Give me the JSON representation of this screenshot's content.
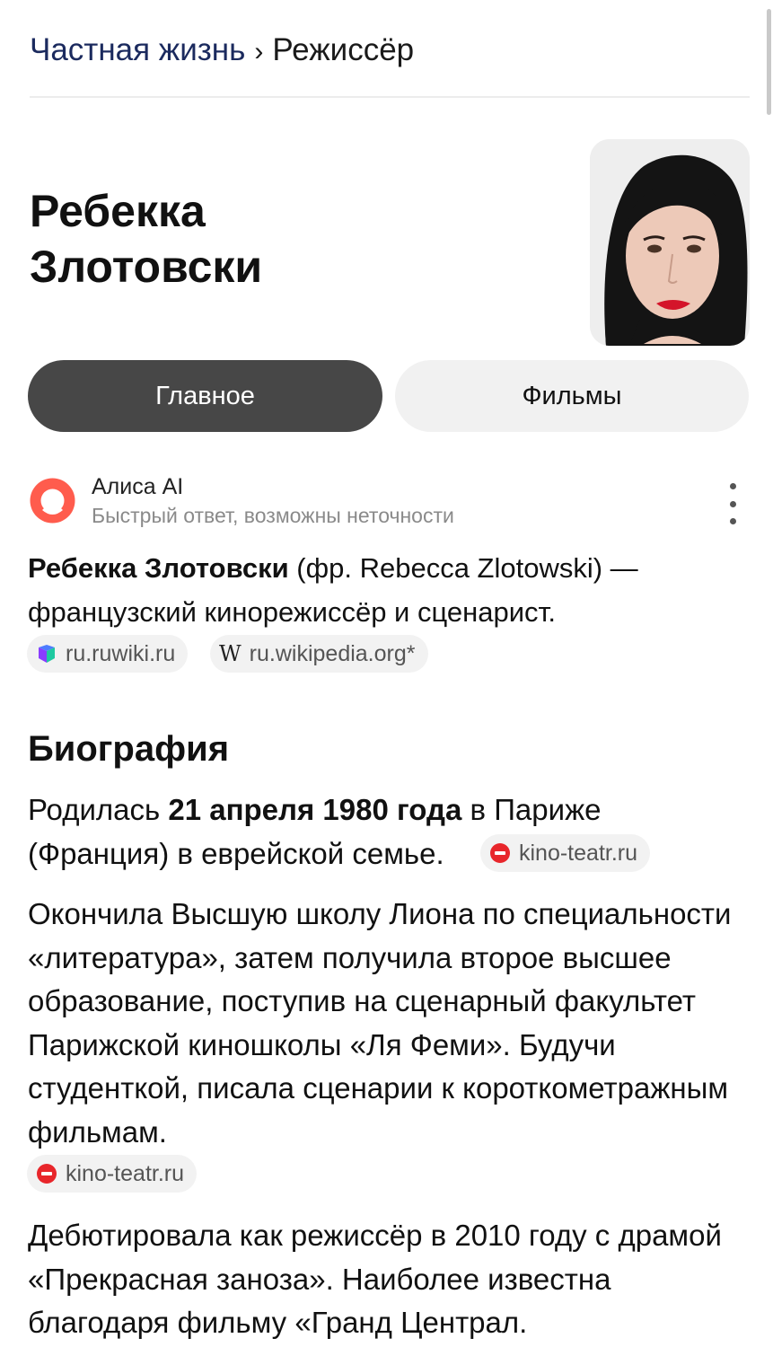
{
  "breadcrumb": {
    "parent": "Частная жизнь",
    "separator": "›",
    "current": "Режиссёр"
  },
  "person": {
    "name_line1": "Ребекка",
    "name_line2": "Злотовски"
  },
  "tabs": [
    {
      "label": "Главное",
      "active": true
    },
    {
      "label": "Фильмы",
      "active": false
    }
  ],
  "alice": {
    "title": "Алиса AI",
    "subtitle": "Быстрый ответ, возможны неточности",
    "summary_name": "Ребекка Злотовски",
    "summary_rest": " (фр. Rebecca Zlotowski) — французский кинорежиссёр и сценарист.",
    "sources": [
      {
        "label": "ru.ruwiki.ru"
      },
      {
        "label": "ru.wikipedia.org*",
        "icon_letter": "W"
      }
    ]
  },
  "biography": {
    "title": "Биография",
    "p1_before": "Родилась ",
    "p1_bold": "21 апреля 1980 года",
    "p1_after": " в Париже (Франция) в еврейской семье.",
    "p1_source": "kino-teatr.ru",
    "p2_text": "Окончила Высшую школу Лиона по специальности «литература», затем получила второе высшее образование, поступив на сценарный факультет Парижской киношколы «Ля Феми». Будучи студенткой, писала сценарии к короткометражным фильмам.",
    "p2_source": "kino-teatr.ru",
    "p3_text": "Дебютировала как режиссёр в 2010 году с драмой «Прекрасная заноза». Наиболее известна благодаря фильму «Гранд Централ."
  },
  "colors": {
    "breadcrumb_link": "#1b2a5e",
    "active_tab": "#474747",
    "inactive_tab": "#f1f1f1",
    "alice_accent": "#ff5c4d",
    "kino_red": "#e8262b"
  },
  "icons": {
    "alice": "alice-logo-icon",
    "ruwiki": "ruwiki-icon",
    "wikipedia": "wikipedia-icon",
    "kino": "kino-teatr-icon",
    "more": "more-vertical-icon"
  }
}
